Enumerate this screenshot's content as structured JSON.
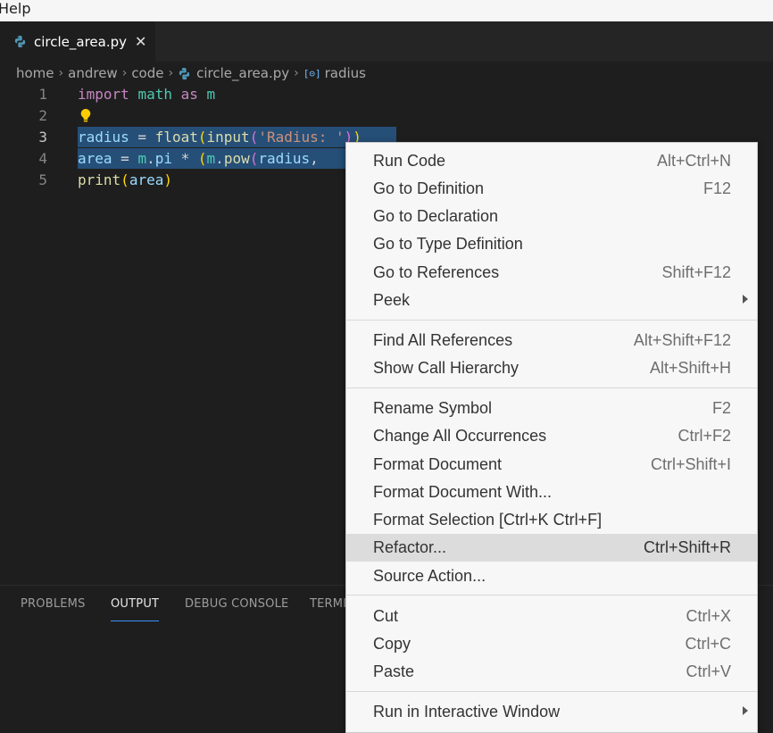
{
  "menubar": {
    "help": "Help"
  },
  "tab": {
    "title": "circle_area.py",
    "close": "✕"
  },
  "breadcrumb": {
    "items": [
      "home",
      "andrew",
      "code",
      "circle_area.py",
      "radius"
    ],
    "sep": "›"
  },
  "editor": {
    "line_numbers": [
      "1",
      "2",
      "3",
      "4",
      "5"
    ],
    "line1": {
      "kw1": "import",
      "mod1": "math",
      "kw2": "as",
      "mod2": "m"
    },
    "line3": {
      "var": "radius",
      "eq": " = ",
      "fn1": "float",
      "p1": "(",
      "fn2": "input",
      "p2": "(",
      "str": "'Radius: '",
      "p3": ")",
      "p4": ")"
    },
    "line4": {
      "var": "area",
      "eq": " = ",
      "mod": "m",
      "dot1": ".",
      "attr": "pi",
      "op": " * ",
      "p1": "(",
      "mod2": "m",
      "dot2": ".",
      "fn": "pow",
      "p2": "(",
      "arg": "radius",
      "comma": ", "
    },
    "line5": {
      "fn": "print",
      "p1": "(",
      "var": "area",
      "p2": ")"
    }
  },
  "panel": {
    "tabs": [
      "PROBLEMS",
      "OUTPUT",
      "DEBUG CONSOLE",
      "TERMI"
    ],
    "active": "OUTPUT"
  },
  "context_menu": {
    "items": [
      {
        "label": "Run Code",
        "shortcut": "Alt+Ctrl+N"
      },
      {
        "label": "Go to Definition",
        "shortcut": "F12"
      },
      {
        "label": "Go to Declaration",
        "shortcut": ""
      },
      {
        "label": "Go to Type Definition",
        "shortcut": ""
      },
      {
        "label": "Go to References",
        "shortcut": "Shift+F12"
      },
      {
        "label": "Peek",
        "shortcut": ""
      },
      {
        "label": "Find All References",
        "shortcut": "Alt+Shift+F12"
      },
      {
        "label": "Show Call Hierarchy",
        "shortcut": "Alt+Shift+H"
      },
      {
        "label": "Rename Symbol",
        "shortcut": "F2"
      },
      {
        "label": "Change All Occurrences",
        "shortcut": "Ctrl+F2"
      },
      {
        "label": "Format Document",
        "shortcut": "Ctrl+Shift+I"
      },
      {
        "label": "Format Document With...",
        "shortcut": ""
      },
      {
        "label": "Format Selection [Ctrl+K Ctrl+F]",
        "shortcut": ""
      },
      {
        "label": "Refactor...",
        "shortcut": "Ctrl+Shift+R"
      },
      {
        "label": "Source Action...",
        "shortcut": ""
      },
      {
        "label": "Cut",
        "shortcut": "Ctrl+X"
      },
      {
        "label": "Copy",
        "shortcut": "Ctrl+C"
      },
      {
        "label": "Paste",
        "shortcut": "Ctrl+V"
      },
      {
        "label": "Run in Interactive Window",
        "shortcut": ""
      }
    ],
    "highlighted": "Refactor...",
    "submenu_items": [
      "Peek",
      "Run in Interactive Window"
    ]
  },
  "colors": {
    "accent": "#3794ff",
    "selection": "#264f78",
    "editor_bg": "#1e1e1e",
    "menu_bg": "#f7f7f7"
  }
}
